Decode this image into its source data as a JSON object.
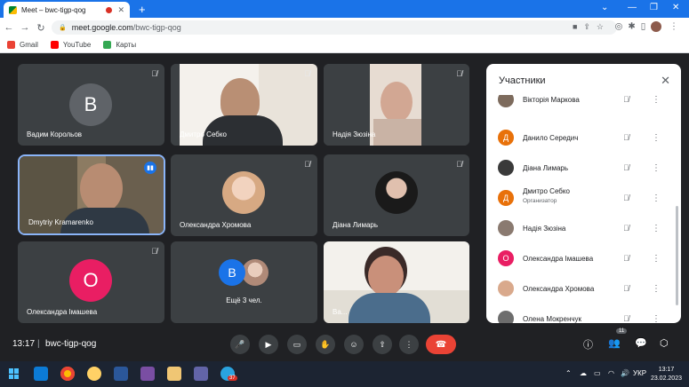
{
  "browser": {
    "tab_title": "Meet – bwc-tigp-qog",
    "new_tab": "+",
    "url_host": "meet.google.com",
    "url_path": "/bwc-tigp-qog",
    "bookmarks": [
      {
        "label": "Gmail",
        "color": "#ea4335"
      },
      {
        "label": "YouTube",
        "color": "#ff0000"
      },
      {
        "label": "Карты",
        "color": "#34a853"
      }
    ]
  },
  "tiles": [
    {
      "name": "Вадим Корольов",
      "type": "letter",
      "letter": "B",
      "color": "#5f6368"
    },
    {
      "name": "Дмитро Себко",
      "type": "video",
      "color": "#c9b9a6"
    },
    {
      "name": "Надія Зюзіна",
      "type": "video",
      "color": "#d7c2b4"
    },
    {
      "name": "Dmytriy Kramarenko",
      "type": "video",
      "color": "#7a6a52"
    },
    {
      "name": "Олександра Хромова",
      "type": "photo",
      "color": "#e6b89a"
    },
    {
      "name": "Діана Лимарь",
      "type": "photo",
      "color": "#2b2b2b"
    },
    {
      "name": "Олександра Імашева",
      "type": "letter",
      "letter": "O",
      "color": "#e91e63"
    },
    {
      "name": "Ещё 3 чел.",
      "type": "group",
      "letter": "B",
      "color": "#1a73e8"
    },
    {
      "name": "Ва...",
      "type": "video",
      "color": "#e8e4dc"
    }
  ],
  "panel": {
    "title": "Участники",
    "participants": [
      {
        "name": "Вікторія Маркова",
        "initial": "",
        "color": "#7d6b5d",
        "role": ""
      },
      {
        "name": "Данило Середич",
        "initial": "Д",
        "color": "#e8710a",
        "role": ""
      },
      {
        "name": "Діана Лимарь",
        "initial": "",
        "color": "#3a3a3a",
        "role": ""
      },
      {
        "name": "Дмитро Себко",
        "initial": "Д",
        "color": "#e8710a",
        "role": "Организатор"
      },
      {
        "name": "Надія Зюзіна",
        "initial": "",
        "color": "#8a7a70",
        "role": ""
      },
      {
        "name": "Олександра Імашева",
        "initial": "O",
        "color": "#e91e63",
        "role": ""
      },
      {
        "name": "Олександра Хромова",
        "initial": "",
        "color": "#d9a98c",
        "role": ""
      },
      {
        "name": "Олена Мокренчук",
        "initial": "",
        "color": "#6d6d6d",
        "role": ""
      }
    ]
  },
  "bottom": {
    "time": "13:17",
    "separator": "|",
    "meeting_code": "bwc-tigp-qog",
    "participants_count": "11"
  },
  "taskbar": {
    "clock_time": "13:17",
    "clock_date": "23.02.2023",
    "lang": "УКР",
    "badge": "37"
  }
}
